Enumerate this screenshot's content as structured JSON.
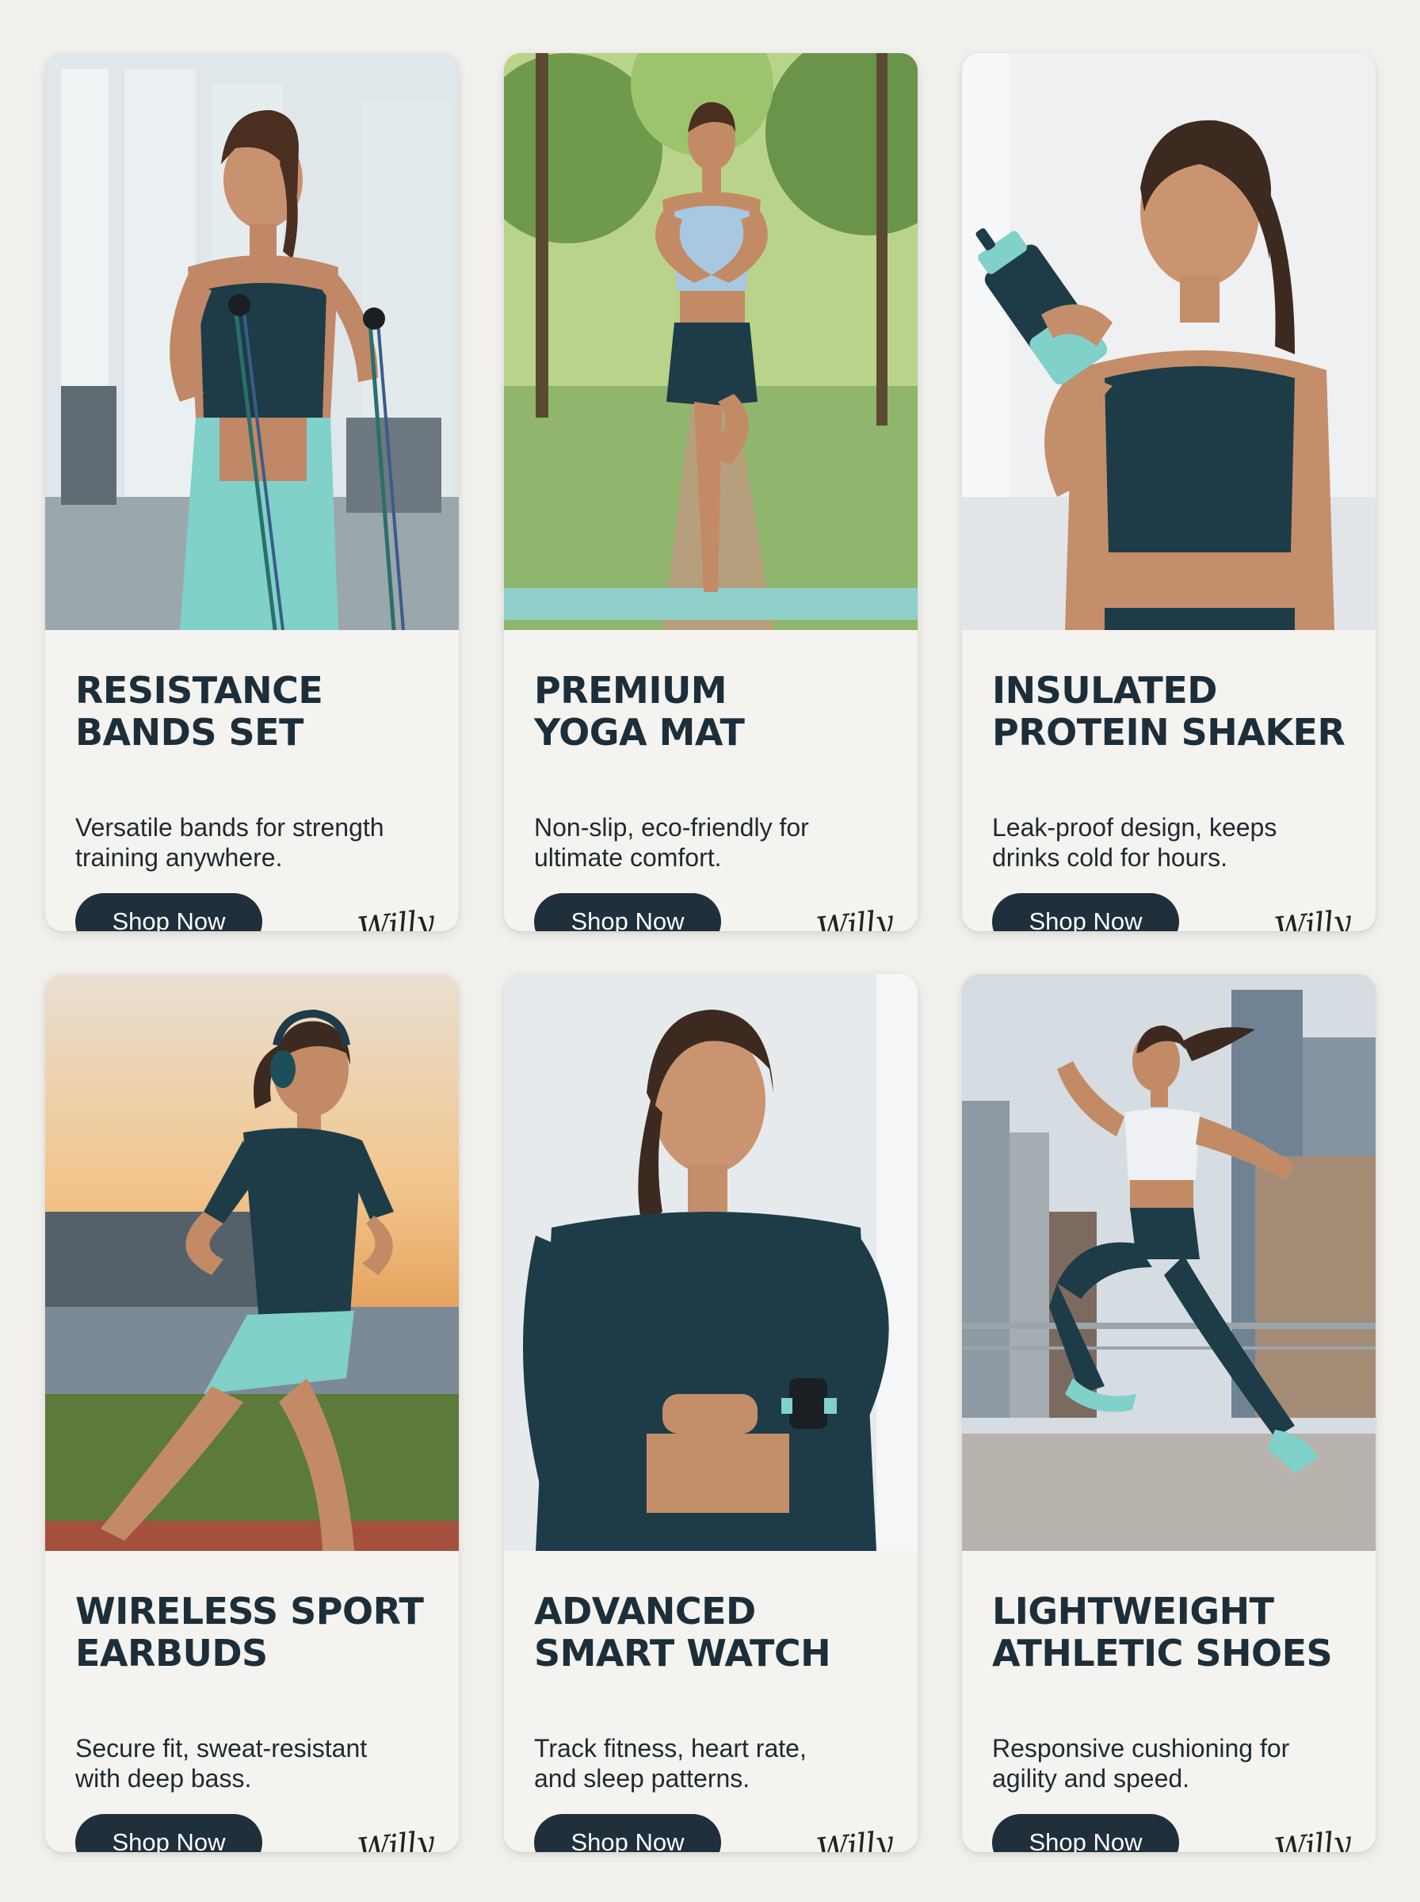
{
  "cards": [
    {
      "title_line1": "RESISTANCE",
      "title_line2": "BANDS SET",
      "desc_line1": "Versatile bands for strength",
      "desc_line2": "training anywhere.",
      "button": "Shop Now",
      "signature": "Willy"
    },
    {
      "title_line1": "PREMIUM",
      "title_line2": "YOGA MAT",
      "desc_line1": "Non-slip, eco-friendly for",
      "desc_line2": "ultimate comfort.",
      "button": "Shop Now",
      "signature": "Willy"
    },
    {
      "title_line1": "INSULATED",
      "title_line2": "PROTEIN SHAKER",
      "desc_line1": "Leak-proof design, keeps",
      "desc_line2": "drinks cold for hours.",
      "button": "Shop Now",
      "signature": "Willy"
    },
    {
      "title_line1": "WIRELESS SPORT",
      "title_line2": "EARBUDS",
      "desc_line1": "Secure fit, sweat-resistant",
      "desc_line2": "with deep bass.",
      "button": "Shop Now",
      "signature": "Willy"
    },
    {
      "title_line1": "ADVANCED",
      "title_line2": "SMART WATCH",
      "desc_line1": "Track fitness, heart rate,",
      "desc_line2": "and sleep patterns.",
      "button": "Shop Now",
      "signature": "Willy"
    },
    {
      "title_line1": "LIGHTWEIGHT",
      "title_line2": "ATHLETIC SHOES",
      "desc_line1": "Responsive cushioning for",
      "desc_line2": "agility and speed.",
      "button": "Shop Now",
      "signature": "Willy"
    }
  ],
  "colors": {
    "background": "#f1f0ec",
    "card": "#f4f3ef",
    "title": "#1c2e3a",
    "button": "#1f2f3b",
    "accent_teal": "#7fd1c9",
    "navy": "#1d3c47"
  }
}
